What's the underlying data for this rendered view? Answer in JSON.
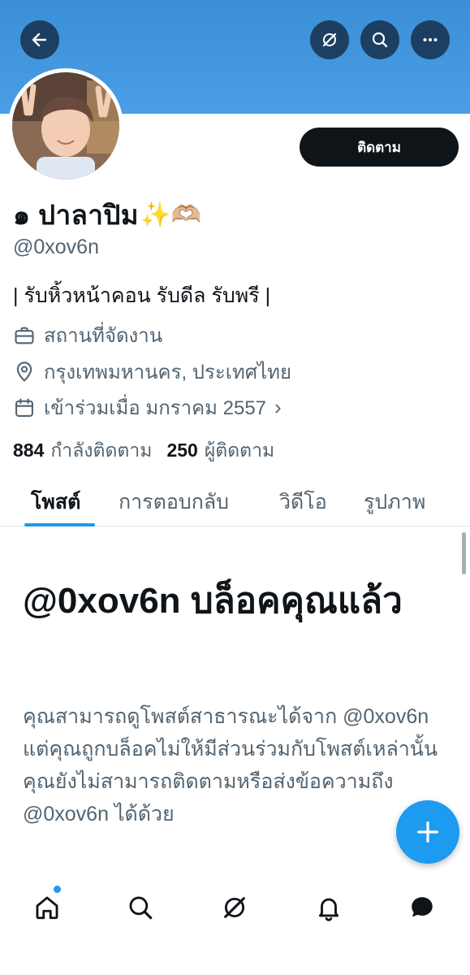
{
  "header": {
    "back_icon": "arrow-left-icon",
    "actions": [
      "grok-icon",
      "search-icon",
      "more-icon"
    ],
    "banner_color": "#4a9ee6"
  },
  "profile": {
    "display_name": "๑ ปาลาปิม",
    "name_emoji": "✨🫶🏼",
    "handle": "@0xov6n",
    "follow_label": "ติดตาม",
    "bio": "| รับหิ้วหน้าคอน รับดีล รับพรี |",
    "category": "สถานที่จัดงาน",
    "location": "กรุงเทพมหานคร, ประเทศไทย",
    "joined": "เข้าร่วมเมื่อ มกราคม 2557",
    "following_count": "884",
    "following_label": "กำลังติดตาม",
    "followers_count": "250",
    "followers_label": "ผู้ติดตาม"
  },
  "tabs": [
    "โพสต์",
    "การตอบกลับ",
    "วิดีโอ",
    "รูปภาพ"
  ],
  "blocked": {
    "title": "@0xov6n บล็อคคุณแล้ว",
    "description": "คุณสามารถดูโพสต์สาธารณะได้จาก @0xov6n แต่คุณถูกบล็อคไม่ให้มีส่วนร่วมกับโพสต์เหล่านั้น คุณยังไม่สามารถติดตามหรือส่งข้อความถึง @0xov6n ได้ด้วย"
  },
  "colors": {
    "accent": "#1d9bf0",
    "text": "#0f1419",
    "muted": "#536471"
  }
}
